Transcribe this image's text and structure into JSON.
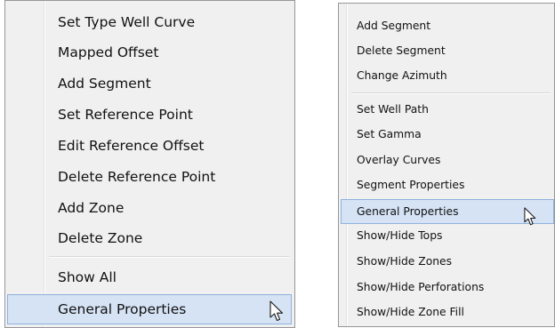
{
  "menu_left": {
    "items_top": [
      "Set Type Well Curve",
      "Mapped Offset",
      "Add Segment",
      "Set Reference Point",
      "Edit Reference Offset",
      "Delete Reference Point",
      "Add Zone",
      "Delete Zone"
    ],
    "items_bottom": [
      "Show All",
      "General Properties"
    ]
  },
  "menu_right": {
    "items_top": [
      "Add Segment",
      "Delete Segment",
      "Change Azimuth"
    ],
    "items_bottom": [
      "Set Well Path",
      "Set Gamma",
      "Overlay Curves",
      "Segment Properties",
      "General Properties",
      "Show/Hide Tops",
      "Show/Hide Zones",
      "Show/Hide Perforations",
      "Show/Hide Zone Fill"
    ]
  },
  "highlighted": "General Properties",
  "icons": {
    "cursor": "mouse-pointer-icon"
  },
  "colors": {
    "menu_bg": "#f0f0f0",
    "highlight_bg": "#d5e3f5",
    "highlight_border": "#8fb1dc"
  }
}
